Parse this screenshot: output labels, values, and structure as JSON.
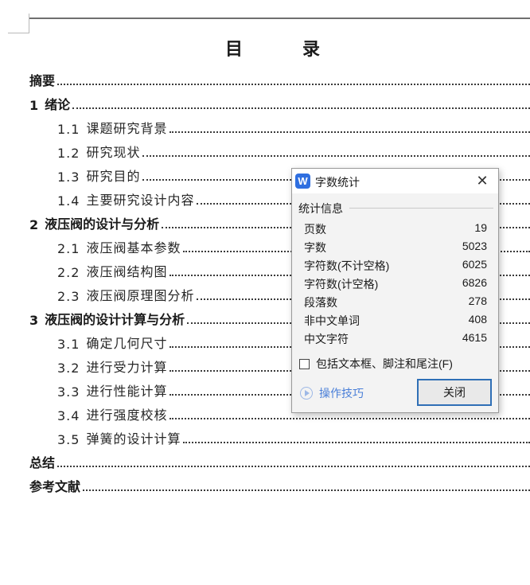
{
  "document": {
    "toc_title_chars": [
      "目",
      "录"
    ],
    "toc": [
      {
        "num": "",
        "label": "摘要",
        "level": 1
      },
      {
        "num": "1",
        "label": "绪论",
        "level": 1
      },
      {
        "num": "1.1",
        "label": "课题研究背景",
        "level": 2
      },
      {
        "num": "1.2",
        "label": "研究现状",
        "level": 2
      },
      {
        "num": "1.3",
        "label": "研究目的",
        "level": 2
      },
      {
        "num": "1.4",
        "label": "主要研究设计内容",
        "level": 2
      },
      {
        "num": "2",
        "label": "液压阀的设计与分析",
        "level": 1
      },
      {
        "num": "2.1",
        "label": "液压阀基本参数",
        "level": 2
      },
      {
        "num": "2.2",
        "label": "液压阀结构图",
        "level": 2
      },
      {
        "num": "2.3",
        "label": "液压阀原理图分析",
        "level": 2
      },
      {
        "num": "3",
        "label": "液压阀的设计计算与分析",
        "level": 1
      },
      {
        "num": "3.1",
        "label": "确定几何尺寸",
        "level": 2
      },
      {
        "num": "3.2",
        "label": "进行受力计算",
        "level": 2
      },
      {
        "num": "3.3",
        "label": "进行性能计算",
        "level": 2
      },
      {
        "num": "3.4",
        "label": "进行强度校核",
        "level": 2
      },
      {
        "num": "3.5",
        "label": "弹簧的设计计算",
        "level": 2
      },
      {
        "num": "",
        "label": "总结",
        "level": 1
      },
      {
        "num": "",
        "label": "参考文献",
        "level": 1
      }
    ]
  },
  "dialog": {
    "title": "字数统计",
    "app_icon": "W",
    "app_icon_name": "wps-writer-icon",
    "close_icon_glyph": "✕",
    "section_title": "统计信息",
    "stats": [
      {
        "label": "页数",
        "value": "19"
      },
      {
        "label": "字数",
        "value": "5023"
      },
      {
        "label": "字符数(不计空格)",
        "value": "6025"
      },
      {
        "label": "字符数(计空格)",
        "value": "6826"
      },
      {
        "label": "段落数",
        "value": "278"
      },
      {
        "label": "非中文单词",
        "value": "408"
      },
      {
        "label": "中文字符",
        "value": "4615"
      }
    ],
    "include_checkbox_label": "包括文本框、脚注和尾注(F)",
    "include_checked": false,
    "tips_label": "操作技巧",
    "close_button_label": "关闭",
    "accent_color": "#2f6fb6",
    "link_color": "#4a7fd8"
  }
}
